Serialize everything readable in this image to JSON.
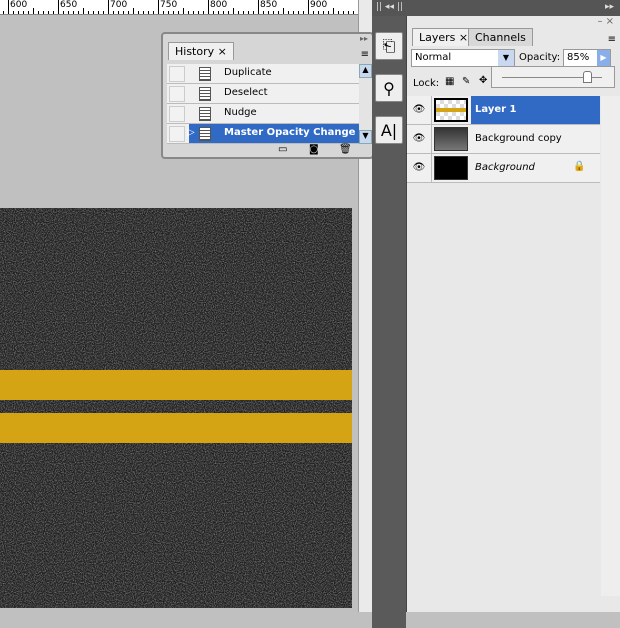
{
  "ruler": {
    "labels": [
      "600",
      "650",
      "700",
      "750",
      "800",
      "850",
      "900"
    ]
  },
  "history": {
    "tab": "History",
    "close": "×",
    "items": [
      {
        "label": "Duplicate",
        "selected": false
      },
      {
        "label": "Deselect",
        "selected": false
      },
      {
        "label": "Nudge",
        "selected": false
      },
      {
        "label": "Master Opacity Change",
        "selected": true
      }
    ]
  },
  "layers": {
    "tabs": [
      "Layers ×",
      "Channels"
    ],
    "blend_mode": "Normal",
    "opacity_label": "Opacity:",
    "opacity_value": "85%",
    "opacity_slider": 0.85,
    "lock_label": "Lock:",
    "items": [
      {
        "name": "Layer 1",
        "selected": true,
        "visible": true,
        "locked": false
      },
      {
        "name": "Background copy",
        "selected": false,
        "visible": true,
        "locked": false
      },
      {
        "name": "Background",
        "selected": false,
        "visible": true,
        "locked": true,
        "italic": true
      }
    ]
  },
  "colors": {
    "selection": "#316ac5",
    "stripe": "#d4a414",
    "asphalt": "#222222"
  }
}
